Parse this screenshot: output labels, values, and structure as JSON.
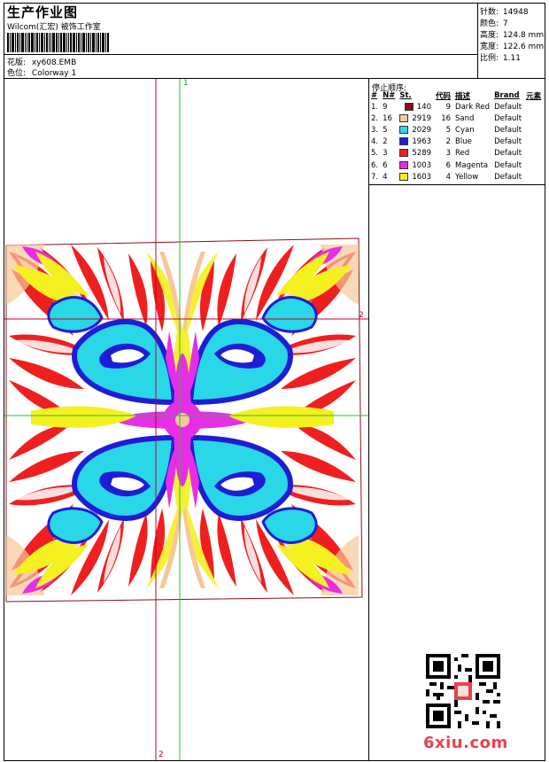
{
  "header": {
    "title": "生产作业图",
    "company": "Wilcom(汇宏) 被饰工作室",
    "design_label": "花版:",
    "design_value": "xy608.EMB",
    "colorway_label": "色位:",
    "colorway_value": "Colorway 1"
  },
  "stats": [
    {
      "label": "针数:",
      "value": "14948"
    },
    {
      "label": "颜色:",
      "value": "7"
    },
    {
      "label": "高度:",
      "value": "124.8 mm"
    },
    {
      "label": "宽度:",
      "value": "122.6 mm"
    },
    {
      "label": "比例:",
      "value": "1.11"
    }
  ],
  "stop_sequence": {
    "title": "停止顺序:",
    "columns": [
      "#",
      "N#",
      "St.",
      "代码",
      "描述",
      "Brand",
      "元素"
    ],
    "rows": [
      {
        "idx": "1.",
        "n": "9",
        "color": "#8b0f1a",
        "st": "140",
        "code": "9",
        "desc": "Dark Red",
        "brand": "Default"
      },
      {
        "idx": "2.",
        "n": "16",
        "color": "#f7c79a",
        "st": "2919",
        "code": "16",
        "desc": "Sand",
        "brand": "Default"
      },
      {
        "idx": "3.",
        "n": "5",
        "color": "#29d7e6",
        "st": "2029",
        "code": "5",
        "desc": "Cyan",
        "brand": "Default"
      },
      {
        "idx": "4.",
        "n": "2",
        "color": "#1d1dd6",
        "st": "1963",
        "code": "2",
        "desc": "Blue",
        "brand": "Default"
      },
      {
        "idx": "5.",
        "n": "3",
        "color": "#f01f1f",
        "st": "5289",
        "code": "3",
        "desc": "Red",
        "brand": "Default"
      },
      {
        "idx": "6.",
        "n": "6",
        "color": "#e62ee6",
        "st": "1003",
        "code": "6",
        "desc": "Magenta",
        "brand": "Default"
      },
      {
        "idx": "7.",
        "n": "4",
        "color": "#f5f020",
        "st": "1603",
        "code": "4",
        "desc": "Yellow",
        "brand": "Default"
      }
    ]
  },
  "axes": {
    "v_top": "1",
    "h_right": "2",
    "v_bottom": "2"
  },
  "watermark": {
    "text": "6xiu.com"
  }
}
